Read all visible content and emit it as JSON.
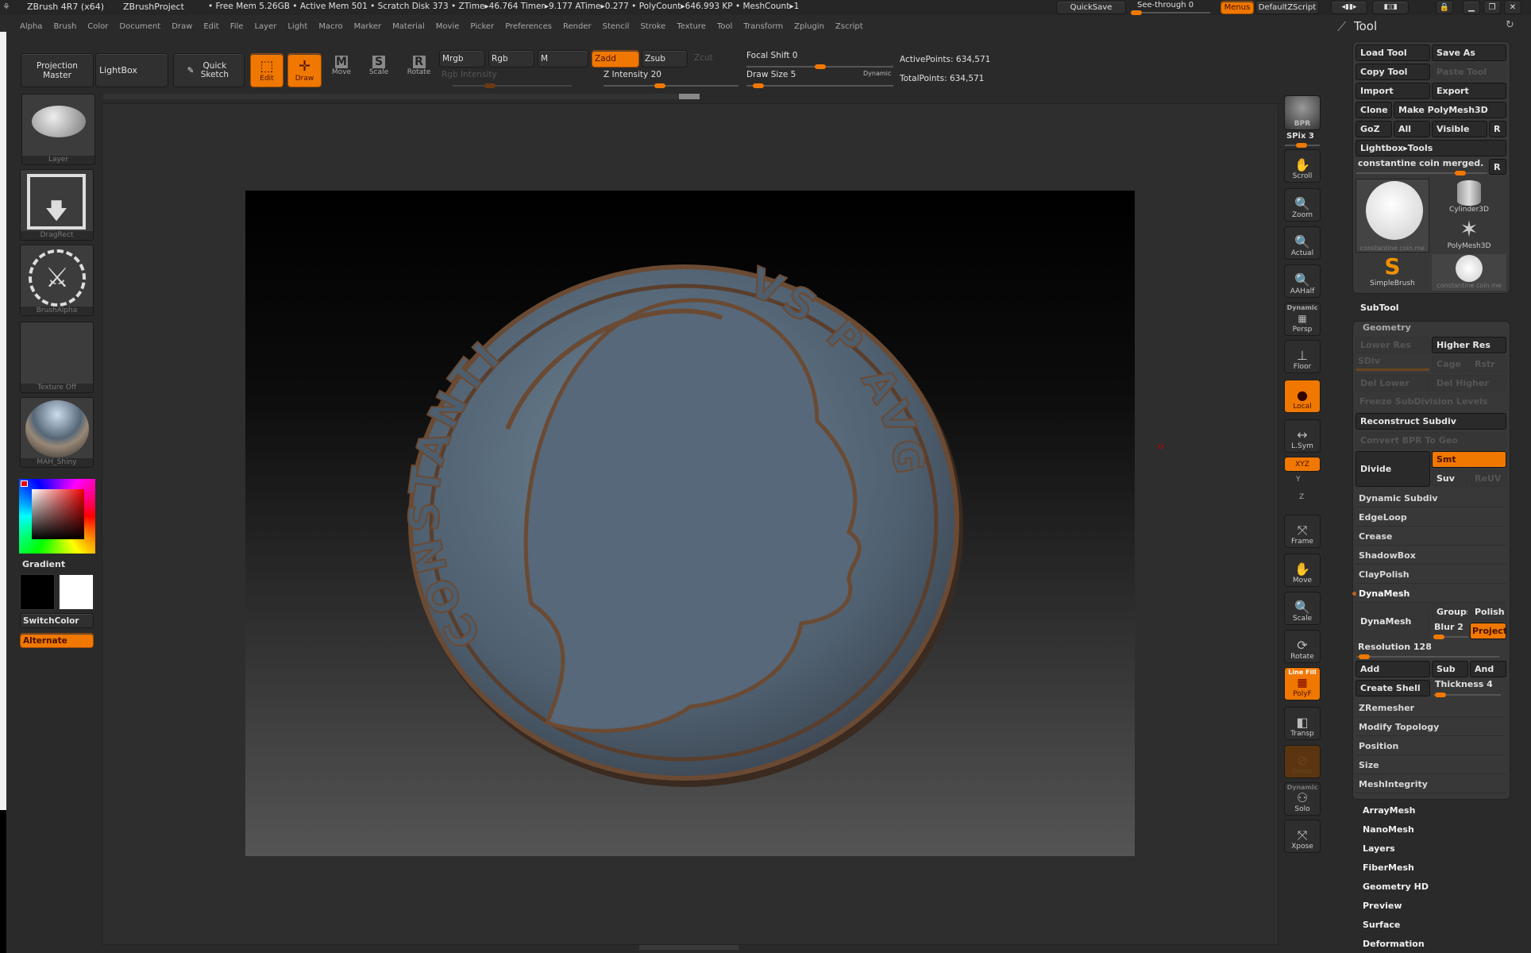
{
  "titlebar": {
    "app": "ZBrush 4R7 (x64)",
    "project": "ZBrushProject",
    "stats": "• Free Mem 5.26GB • Active Mem 501 • Scratch Disk 373 •  ZTime▸46.764 Timer▸9.177 ATime▸0.277 • PolyCount▸646.993 KP  • MeshCount▸1",
    "quicksave": "QuickSave",
    "seethrough": "See-through  0",
    "seethrough_value": 0,
    "menus": "Menus",
    "defaultzscript": "DefaultZScript"
  },
  "menubar": [
    "Alpha",
    "Brush",
    "Color",
    "Document",
    "Draw",
    "Edit",
    "File",
    "Layer",
    "Light",
    "Macro",
    "Marker",
    "Material",
    "Movie",
    "Picker",
    "Preferences",
    "Render",
    "Stencil",
    "Stroke",
    "Texture",
    "Tool",
    "Transform",
    "Zplugin",
    "Zscript"
  ],
  "toolbar": {
    "projection_master": "Projection Master",
    "lightbox": "LightBox",
    "quick_sketch": "Quick Sketch",
    "edit": "Edit",
    "draw": "Draw",
    "move": "Move",
    "scale": "Scale",
    "rotate": "Rotate",
    "mrgb": "Mrgb",
    "rgb": "Rgb",
    "m": "M",
    "zadd": "Zadd",
    "zsub": "Zsub",
    "zcut": "Zcut",
    "rgb_intensity": "Rgb Intensity",
    "z_intensity": "Z Intensity 20",
    "focal_shift": "Focal Shift 0",
    "draw_size": "Draw Size 5",
    "dynamic": "Dynamic",
    "active_points": "ActivePoints: 634,571",
    "total_points": "TotalPoints: 634,571",
    "z_intensity_value": 20,
    "focal_shift_value": 0,
    "draw_size_value": 5
  },
  "left_shelf": {
    "brush": "Layer",
    "stroke": "DragRect",
    "alpha": "BrushAlpha",
    "texture": "Texture Off",
    "material": "MAH_Shiny",
    "gradient": "Gradient",
    "switchcolor": "SwitchColor",
    "alternate": "Alternate",
    "main_color": "#000000",
    "secondary_color": "#ffffff"
  },
  "right_shelf": {
    "bpr": "BPR",
    "spix": "SPix 3",
    "scroll": "Scroll",
    "zoom": "Zoom",
    "actual": "Actual",
    "aahalf": "AAHalf",
    "dynamic": "Dynamic",
    "persp": "Persp",
    "floor": "Floor",
    "local": "Local",
    "lsym": "L.Sym",
    "xyz": "XYZ",
    "y": "Y",
    "z": "Z",
    "frame": "Frame",
    "move": "Move",
    "scale": "Scale",
    "rotate": "Rotate",
    "linefill": "Line Fill",
    "polyf": "PolyF",
    "transp": "Transp",
    "ghost": "Ghost",
    "dynamic2": "Dynamic",
    "solo": "Solo",
    "xpose": "Xpose"
  },
  "tool": {
    "title": "Tool",
    "load": "Load Tool",
    "saveas": "Save As",
    "copy": "Copy Tool",
    "paste": "Paste Tool",
    "import": "Import",
    "export": "Export",
    "clone": "Clone",
    "make_polymesh": "Make PolyMesh3D",
    "goz": "GoZ",
    "all": "All",
    "visible": "Visible",
    "r": "R",
    "lightbox_tools": "Lightbox▸Tools",
    "current": "constantine coin merged.",
    "thumbs": [
      "constantine coin me",
      "Cylinder3D",
      "PolyMesh3D",
      "SimpleBrush",
      "constantine coin me"
    ],
    "subtool": "SubTool",
    "geometry": "Geometry",
    "lower_res": "Lower Res",
    "higher_res": "Higher Res",
    "sdiv": "SDiv",
    "cage": "Cage",
    "rstr": "Rstr",
    "del_lower": "Del Lower",
    "del_higher": "Del Higher",
    "freeze": "Freeze SubDivision Levels",
    "reconstruct": "Reconstruct Subdiv",
    "convert_bpr": "Convert BPR To Geo",
    "divide": "Divide",
    "smt": "Smt",
    "suv": "Suv",
    "reuv": "ReUV",
    "sections": [
      "Dynamic Subdiv",
      "EdgeLoop",
      "Crease",
      "ShadowBox",
      "ClayPolish"
    ],
    "dynamesh": "DynaMesh",
    "dynamesh_btn": "DynaMesh",
    "groups": "Groups",
    "polish": "Polish",
    "blur": "Blur 2",
    "project": "Project",
    "resolution": "Resolution 128",
    "resolution_value": 128,
    "add": "Add",
    "sub": "Sub",
    "and": "And",
    "create_shell": "Create Shell",
    "thickness": "Thickness 4",
    "thickness_value": 4,
    "sections2": [
      "ZRemesher",
      "Modify Topology",
      "Position",
      "Size",
      "MeshIntegrity"
    ],
    "subpalettes": [
      "ArrayMesh",
      "NanoMesh",
      "Layers",
      "FiberMesh",
      "Geometry HD",
      "Preview",
      "Surface",
      "Deformation"
    ]
  },
  "coin": {
    "legend_left": "CONSTANTI",
    "legend_right": "VS P AVG"
  },
  "colors": {
    "accent": "#f07800",
    "bg": "#2a2a2a"
  }
}
